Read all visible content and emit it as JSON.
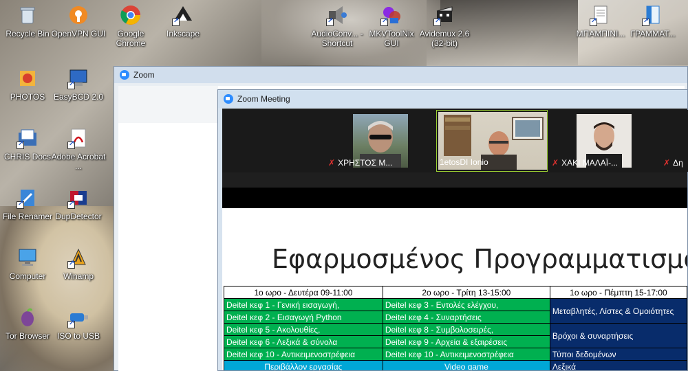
{
  "desktop": {
    "icons": [
      {
        "label": "Recycle Bin",
        "icon": "recycle-bin-icon"
      },
      {
        "label": "OpenVPN GUI",
        "icon": "openvpn-icon"
      },
      {
        "label": "Google Chrome",
        "icon": "chrome-icon"
      },
      {
        "label": "Inkscape",
        "icon": "inkscape-icon"
      },
      {
        "label": "AudioConv... - Shortcut",
        "icon": "audio-converter-icon"
      },
      {
        "label": "MKVToolNix GUI",
        "icon": "mkvtoolnix-icon"
      },
      {
        "label": "Avidemux 2.6 (32-bit)",
        "icon": "avidemux-icon"
      },
      {
        "label": "ΜΠΑΜΠΙΝΙ...",
        "icon": "document-icon"
      },
      {
        "label": "ΓΡΑΜΜΑΤ...",
        "icon": "document-icon"
      },
      {
        "label": "PHOTOS",
        "icon": "photos-icon"
      },
      {
        "label": "EasyBCD 2.0",
        "icon": "easybcd-icon"
      },
      {
        "label": "CHRIS Docs",
        "icon": "folder-docs-icon"
      },
      {
        "label": "Adobe Acrobat ...",
        "icon": "acrobat-icon"
      },
      {
        "label": "File Renamer",
        "icon": "file-renamer-icon"
      },
      {
        "label": "DupDetector",
        "icon": "dupdetector-icon"
      },
      {
        "label": "Computer",
        "icon": "computer-icon"
      },
      {
        "label": "Winamp",
        "icon": "winamp-icon"
      },
      {
        "label": "Tor Browser",
        "icon": "tor-browser-icon"
      },
      {
        "label": "ISO to USB",
        "icon": "iso-to-usb-icon"
      }
    ]
  },
  "zoom_window": {
    "title": "Zoom"
  },
  "meeting_window": {
    "title": "Zoom Meeting",
    "participants": [
      {
        "name": "ΧΡΗΣΤΟΣ Μ...",
        "muted": true
      },
      {
        "name": "1etosDI Ionio",
        "muted": false,
        "active": true
      },
      {
        "name": "ΧΑΚΙ ΜΑΛΑΪ-...",
        "muted": true
      },
      {
        "name": "Δη",
        "muted": true
      }
    ]
  },
  "slide": {
    "title": "Εφαρμοσμένος Προγραμματισμός",
    "columns": [
      "1ο ωρο - Δευτέρα 09-11:00",
      "2ο ωρο - Τρίτη 13-15:00",
      "1ο ωρο - Πέμπτη 15-17:00"
    ],
    "rows": [
      {
        "c1": "Deitel κεφ 1 - Γενική εισαγωγή,",
        "c2": "Deitel κεφ 3 - Εντολές ελέγχου,"
      },
      {
        "c1": "Deitel κεφ 2 - Εισαγωγή Python",
        "c2": "Deitel κεφ 4 - Συναρτήσεις"
      },
      {
        "c1": "Deitel κεφ 5 - Ακολουθίες,",
        "c2": "Deitel κεφ 8 - Συμβολοσειρές,"
      },
      {
        "c1": "Deitel κεφ 6 - Λεξικά & σύνολα",
        "c2": "Deitel κεφ 9 - Αρχεία & εξαιρέσεις"
      },
      {
        "c1": "Deitel κεφ 10 - Αντικειμενοστρέφεια",
        "c2": "Deitel κεφ 10 - Αντικειμενοστρέφεια",
        "c3": "Τύποι δεδομένων"
      },
      {
        "c1": "Περιβάλλον εργασίας",
        "c2": "Video game",
        "c3": "Λεξικά"
      }
    ],
    "merged": [
      "Μεταβλητές, Λίστες & Ομοιότητες",
      "Βρόχοι & συναρτήσεις"
    ]
  },
  "colors": {
    "green": "#00b050",
    "navy": "#082c6b",
    "cyan": "#00a6d6",
    "zoom_blue": "#2d8cff"
  }
}
